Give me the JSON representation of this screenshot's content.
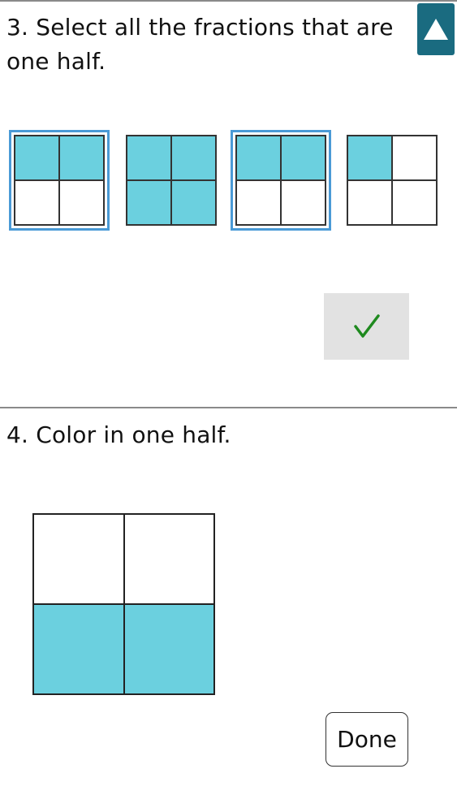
{
  "q3": {
    "line1": "3. Select all the fractions that are",
    "line2": "one half."
  },
  "q3_options": [
    {
      "name": "fraction-option-1",
      "selected": true,
      "shaded": [
        1,
        1,
        0,
        0
      ]
    },
    {
      "name": "fraction-option-2",
      "selected": false,
      "shaded": [
        1,
        1,
        1,
        1
      ]
    },
    {
      "name": "fraction-option-3",
      "selected": true,
      "shaded": [
        1,
        1,
        0,
        0
      ]
    },
    {
      "name": "fraction-option-4",
      "selected": false,
      "shaded": [
        1,
        0,
        0,
        0
      ]
    }
  ],
  "q4": {
    "prompt": "4. Color in one half.",
    "grid_shaded": [
      0,
      0,
      1,
      1
    ]
  },
  "buttons": {
    "done_label": "Done",
    "check_icon": "checkmark-icon",
    "scroll_icon": "up-triangle-icon"
  },
  "colors": {
    "fill": "#6bd0df",
    "selection_border": "#4a9ad6",
    "scroll_button": "#1a6b80",
    "check_green": "#1f8a1f"
  }
}
